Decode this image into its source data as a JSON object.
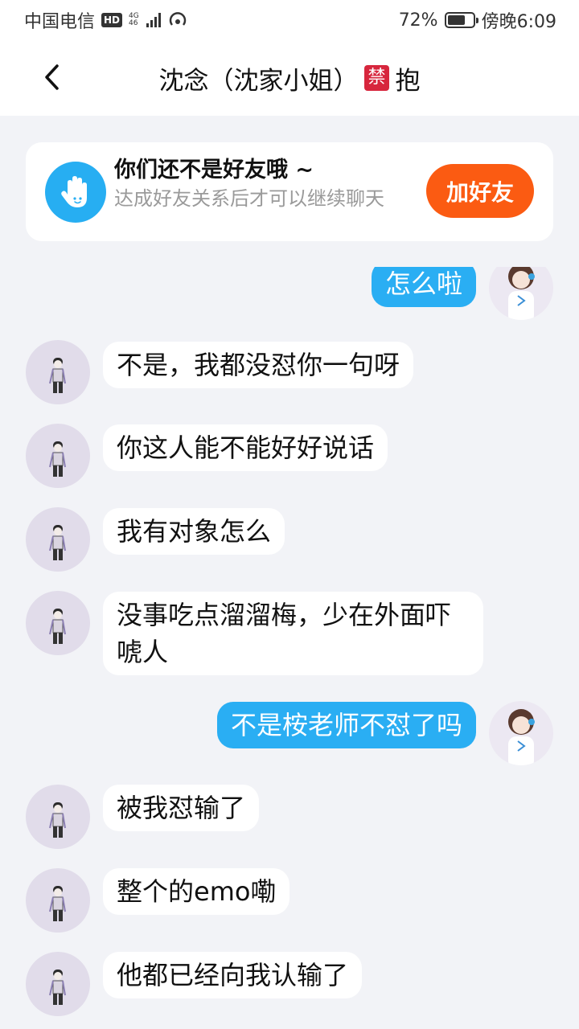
{
  "status_bar": {
    "carrier": "中国电信",
    "hd": "HD",
    "net_type": "4G",
    "net_sub": "46",
    "battery_pct": "72%",
    "battery_level": 0.72,
    "time": "傍晚6:09"
  },
  "header": {
    "title": "沈念（沈家小姐）",
    "badge": "禁",
    "suffix": "抱"
  },
  "friend_banner": {
    "title": "你们还不是好友哦 ~",
    "description": "达成好友关系后才可以继续聊天",
    "button": "加好友"
  },
  "messages": [
    {
      "sender": "self",
      "text": "怎么啦"
    },
    {
      "sender": "other",
      "text": "不是，我都没怼你一句呀"
    },
    {
      "sender": "other",
      "text": "你这人能不能好好说话"
    },
    {
      "sender": "other",
      "text": "我有对象怎么"
    },
    {
      "sender": "other",
      "text": "没事吃点溜溜梅，少在外面吓唬人"
    },
    {
      "sender": "self",
      "text": "不是桉老师不怼了吗"
    },
    {
      "sender": "other",
      "text": "被我怼输了"
    },
    {
      "sender": "other",
      "text": "整个的emo嘞"
    },
    {
      "sender": "other",
      "text": "他都已经向我认输了"
    }
  ],
  "colors": {
    "accent_blue": "#2aaef3",
    "button_orange": "#fb5b12",
    "badge_red": "#d7263d"
  }
}
